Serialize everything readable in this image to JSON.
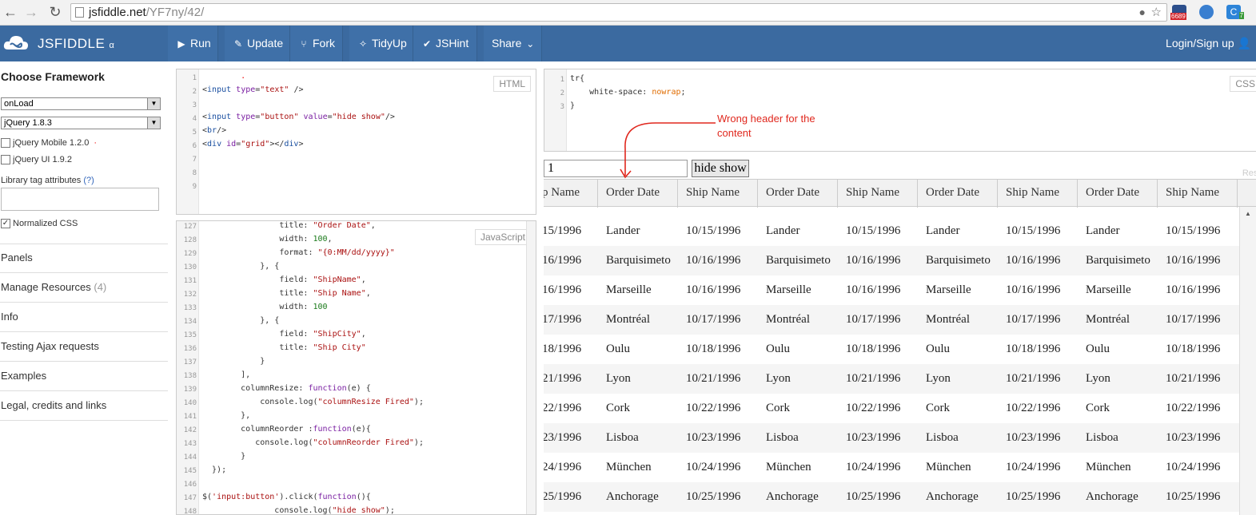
{
  "browser": {
    "url_domain": "jsfiddle.net",
    "url_path": "/YF7ny/42/",
    "ext_badge": "6689",
    "ext_badge2": "7"
  },
  "header": {
    "logo": "JSFIDDLE",
    "logo_suffix": "α",
    "buttons": [
      {
        "label": "Run",
        "icon": "▶"
      },
      {
        "label": "Update",
        "icon": "✎"
      },
      {
        "label": "Fork",
        "icon": "⑂"
      },
      {
        "label": "TidyUp",
        "icon": "✧"
      },
      {
        "label": "JSHint",
        "icon": "✔"
      },
      {
        "label": "Share",
        "icon": "⌄"
      }
    ],
    "login": "Login/Sign up"
  },
  "sidebar": {
    "title": "Choose Framework",
    "load_select": "onLoad",
    "framework_select": "jQuery 1.8.3",
    "libs": [
      {
        "label": "jQuery Mobile 1.2.0",
        "checked": false
      },
      {
        "label": "jQuery UI 1.9.2",
        "checked": false
      }
    ],
    "lib_attr_label": "Library tag attributes",
    "lib_attr_help": "(?)",
    "normalized_css": "Normalized CSS",
    "items": [
      "Panels",
      "Manage Resources",
      "Info",
      "Testing Ajax requests",
      "Examples",
      "Legal, credits and links"
    ],
    "resources_count": "(4)"
  },
  "html_panel": {
    "tag": "HTML",
    "line_numbers": [
      "1",
      "2",
      "3",
      "4",
      "5",
      "6",
      "7",
      "8",
      "9"
    ]
  },
  "css_panel": {
    "tag": "CSS",
    "line_numbers": [
      "1",
      "2",
      "3"
    ]
  },
  "js_panel": {
    "tag": "JavaScript",
    "line_numbers": [
      "127",
      "128",
      "129",
      "130",
      "131",
      "132",
      "133",
      "134",
      "135",
      "136",
      "137",
      "138",
      "139",
      "140",
      "141",
      "142",
      "143",
      "144",
      "145",
      "146",
      "147",
      "148"
    ]
  },
  "result": {
    "input_value": "1",
    "button_label": "hide show",
    "corner_label": "Result",
    "headers": [
      "p Name",
      "Order Date",
      "Ship Name",
      "Order Date",
      "Ship Name",
      "Order Date",
      "Ship Name",
      "Order Date",
      "Ship Name"
    ],
    "rows": [
      [
        "15/1996",
        "Lander",
        "10/15/1996",
        "Lander",
        "10/15/1996",
        "Lander",
        "10/15/1996",
        "Lander",
        "10/15/1996"
      ],
      [
        "16/1996",
        "Barquisimeto",
        "10/16/1996",
        "Barquisimeto",
        "10/16/1996",
        "Barquisimeto",
        "10/16/1996",
        "Barquisimeto",
        "10/16/1996"
      ],
      [
        "16/1996",
        "Marseille",
        "10/16/1996",
        "Marseille",
        "10/16/1996",
        "Marseille",
        "10/16/1996",
        "Marseille",
        "10/16/1996"
      ],
      [
        "17/1996",
        "Montréal",
        "10/17/1996",
        "Montréal",
        "10/17/1996",
        "Montréal",
        "10/17/1996",
        "Montréal",
        "10/17/1996"
      ],
      [
        "18/1996",
        "Oulu",
        "10/18/1996",
        "Oulu",
        "10/18/1996",
        "Oulu",
        "10/18/1996",
        "Oulu",
        "10/18/1996"
      ],
      [
        "21/1996",
        "Lyon",
        "10/21/1996",
        "Lyon",
        "10/21/1996",
        "Lyon",
        "10/21/1996",
        "Lyon",
        "10/21/1996"
      ],
      [
        "22/1996",
        "Cork",
        "10/22/1996",
        "Cork",
        "10/22/1996",
        "Cork",
        "10/22/1996",
        "Cork",
        "10/22/1996"
      ],
      [
        "23/1996",
        "Lisboa",
        "10/23/1996",
        "Lisboa",
        "10/23/1996",
        "Lisboa",
        "10/23/1996",
        "Lisboa",
        "10/23/1996"
      ],
      [
        "24/1996",
        "München",
        "10/24/1996",
        "München",
        "10/24/1996",
        "München",
        "10/24/1996",
        "München",
        "10/24/1996"
      ],
      [
        "25/1996",
        "Anchorage",
        "10/25/1996",
        "Anchorage",
        "10/25/1996",
        "Anchorage",
        "10/25/1996",
        "Anchorage",
        "10/25/1996"
      ]
    ]
  },
  "annotation": "Wrong header for the content",
  "colors": {
    "header_bg": "#3b6aa0",
    "annotation": "#e0281e"
  }
}
